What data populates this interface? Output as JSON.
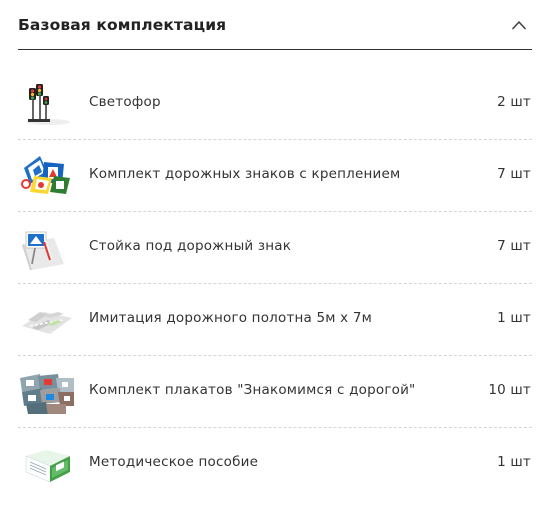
{
  "section": {
    "title": "Базовая комплектация",
    "toggle_icon": "chevron-up-icon"
  },
  "items": [
    {
      "name": "Светофор",
      "qty": "2 шт",
      "icon": "traffic-light-image"
    },
    {
      "name": "Комплект дорожных знаков с креплением",
      "qty": "7 шт",
      "icon": "road-signs-set-image"
    },
    {
      "name": "Стойка под дорожный знак",
      "qty": "7 шт",
      "icon": "sign-stand-image"
    },
    {
      "name": "Имитация дорожного полотна 5м х 7м",
      "qty": "1 шт",
      "icon": "road-surface-mat-image"
    },
    {
      "name": "Комплект плакатов \"Знакомимся с дорогой\"",
      "qty": "10 шт",
      "icon": "posters-set-image"
    },
    {
      "name": "Методическое пособие",
      "qty": "1 шт",
      "icon": "manual-book-image"
    }
  ]
}
